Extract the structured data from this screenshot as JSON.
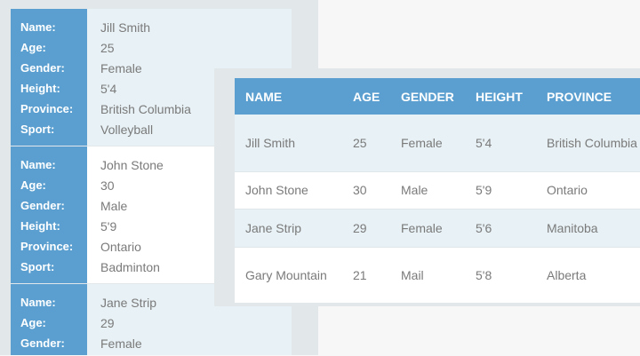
{
  "fields": {
    "name": "Name:",
    "age": "Age:",
    "gender": "Gender:",
    "height": "Height:",
    "province": "Province:",
    "sport": "Sport:"
  },
  "cards": [
    {
      "name": "Jill Smith",
      "age": "25",
      "gender": "Female",
      "height": "5'4",
      "province": "British Columbia",
      "sport": "Volleyball"
    },
    {
      "name": "John Stone",
      "age": "30",
      "gender": "Male",
      "height": "5'9",
      "province": "Ontario",
      "sport": "Badminton"
    },
    {
      "name": "Jane Strip",
      "age": "29",
      "gender": "Female"
    }
  ],
  "table": {
    "headers": [
      "NAME",
      "AGE",
      "GENDER",
      "HEIGHT",
      "PROVINCE"
    ],
    "rows": [
      [
        "Jill Smith",
        "25",
        "Female",
        "5'4",
        "British Columbia"
      ],
      [
        "John Stone",
        "30",
        "Male",
        "5'9",
        "Ontario"
      ],
      [
        "Jane Strip",
        "29",
        "Female",
        "5'6",
        "Manitoba"
      ],
      [
        "Gary Mountain",
        "21",
        "Mail",
        "5'8",
        "Alberta"
      ]
    ]
  },
  "colors": {
    "accent": "#5a9fcf",
    "stripe": "#e8f1f5"
  }
}
